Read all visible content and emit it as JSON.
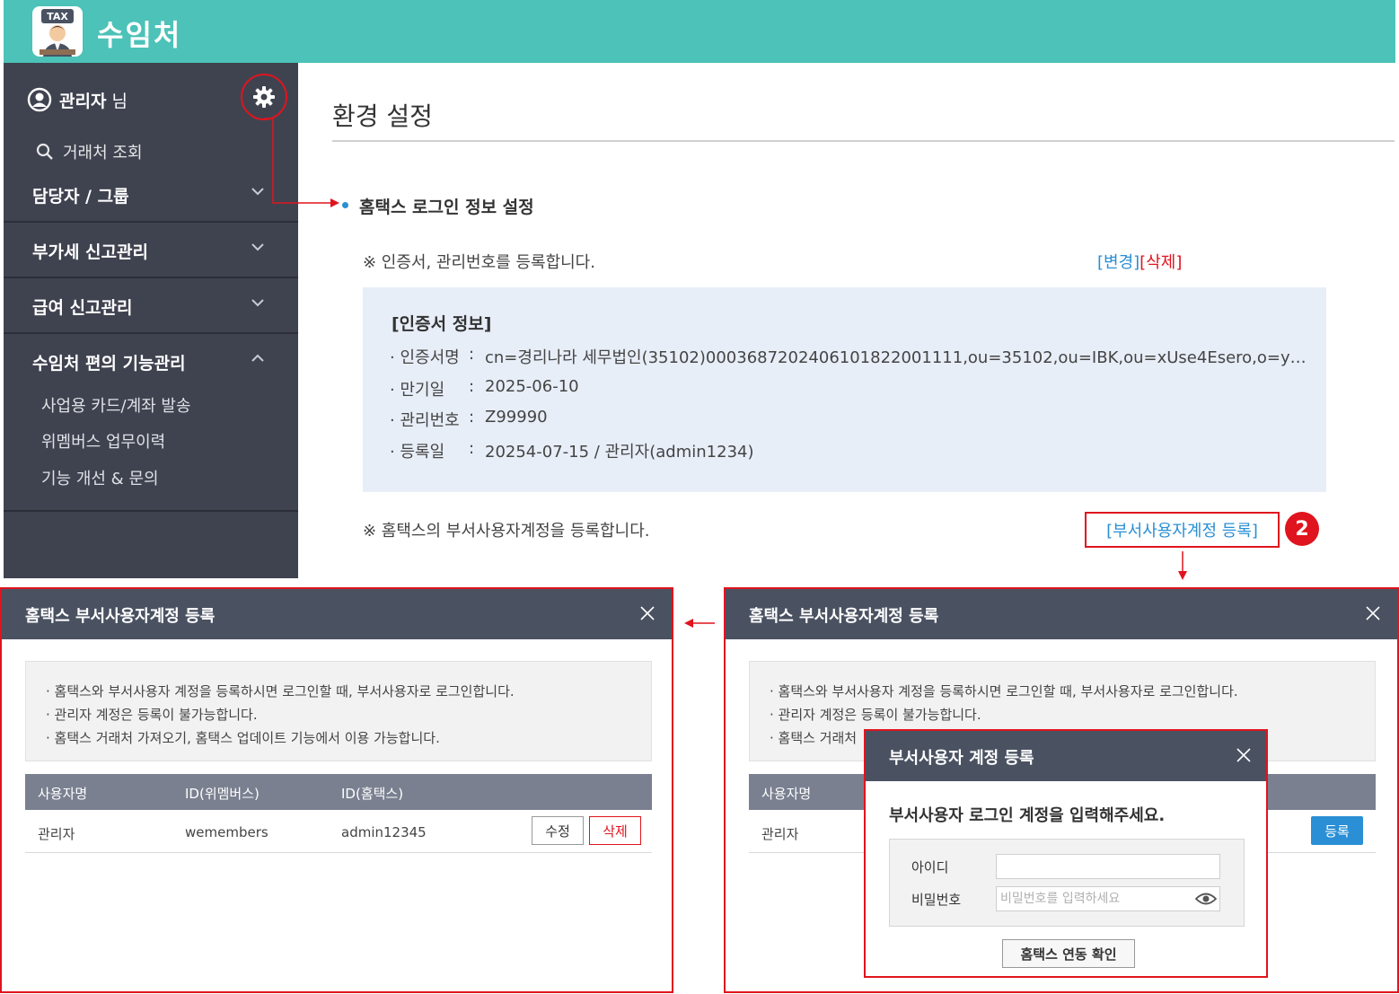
{
  "app": {
    "title": "수임처",
    "logo_text": "TAX"
  },
  "sidebar": {
    "user_name": "관리자",
    "user_suffix": "님",
    "search_label": "거래처 조회",
    "sections": [
      {
        "label": "담당자 / 그룹",
        "expanded": false
      },
      {
        "label": "부가세 신고관리",
        "expanded": false
      },
      {
        "label": "급여 신고관리",
        "expanded": false
      },
      {
        "label": "수임처 편의 기능관리",
        "expanded": true
      }
    ],
    "sub_items": [
      "사업용 카드/계좌 발송",
      "위멤버스 업무이력",
      "기능 개선 & 문의"
    ]
  },
  "main": {
    "page_title": "환경 설정",
    "section_title": "홈택스 로그인 정보 설정",
    "notice_cert": "※ 인증서, 관리번호를 등록합니다.",
    "link_change": "[변경]",
    "link_delete": "[삭제]",
    "cert": {
      "heading": "[인증서 정보]",
      "rows": [
        {
          "key": "· 인증서명",
          "value": "cn=경리나라 세무법인(35102)0003687202406101822001111,ou=35102,ou=IBK,ou=xUse4Esero,o=yes…"
        },
        {
          "key": "· 만기일",
          "value": "2025-06-10"
        },
        {
          "key": "· 관리번호",
          "value": "Z99990"
        },
        {
          "key": "· 등록일",
          "value": "20254-07-15 / 관리자(admin1234)"
        }
      ],
      "colon": ":"
    },
    "notice_dept": "※ 홈택스의 부서사용자계정을 등록합니다.",
    "dept_link": "[부서사용자계정 등록]",
    "badge": "2"
  },
  "modal": {
    "title": "홈택스 부서사용자계정 등록",
    "info_lines": [
      "· 홈택스와 부서사용자 계정을 등록하시면 로그인할 때, 부서사용자로 로그인합니다.",
      "· 관리자 계정은 등록이 불가능합니다.",
      "· 홈택스 거래처 가져오기, 홈택스 업데이트 기능에서 이용 가능합니다."
    ],
    "info_line3_truncated": "· 홈택스 거래처",
    "columns": [
      "사용자명",
      "ID(위멤버스)",
      "ID(홈택스)"
    ],
    "row": {
      "user": "관리자",
      "wemembers_id": "wemembers",
      "hometax_id": "admin12345"
    },
    "btn_edit": "수정",
    "btn_delete": "삭제",
    "btn_register": "등록"
  },
  "dialog": {
    "title": "부서사용자 계정 등록",
    "prompt": "부서사용자 로그인 계정을 입력해주세요.",
    "id_label": "아이디",
    "id_value": "",
    "pw_label": "비밀번호",
    "pw_placeholder": "비밀번호를 입력하세요",
    "confirm": "홈택스 연동 확인"
  },
  "colors": {
    "header": "#4cc2b8",
    "sidebar": "#3f4350",
    "accent_red": "#e0141e",
    "link_blue": "#2a8fd5",
    "modal_head": "#4a5262"
  },
  "icons": [
    "user-circle-icon",
    "gear-icon",
    "search-icon",
    "chevron-down-icon",
    "chevron-up-icon",
    "close-icon",
    "eye-icon"
  ]
}
